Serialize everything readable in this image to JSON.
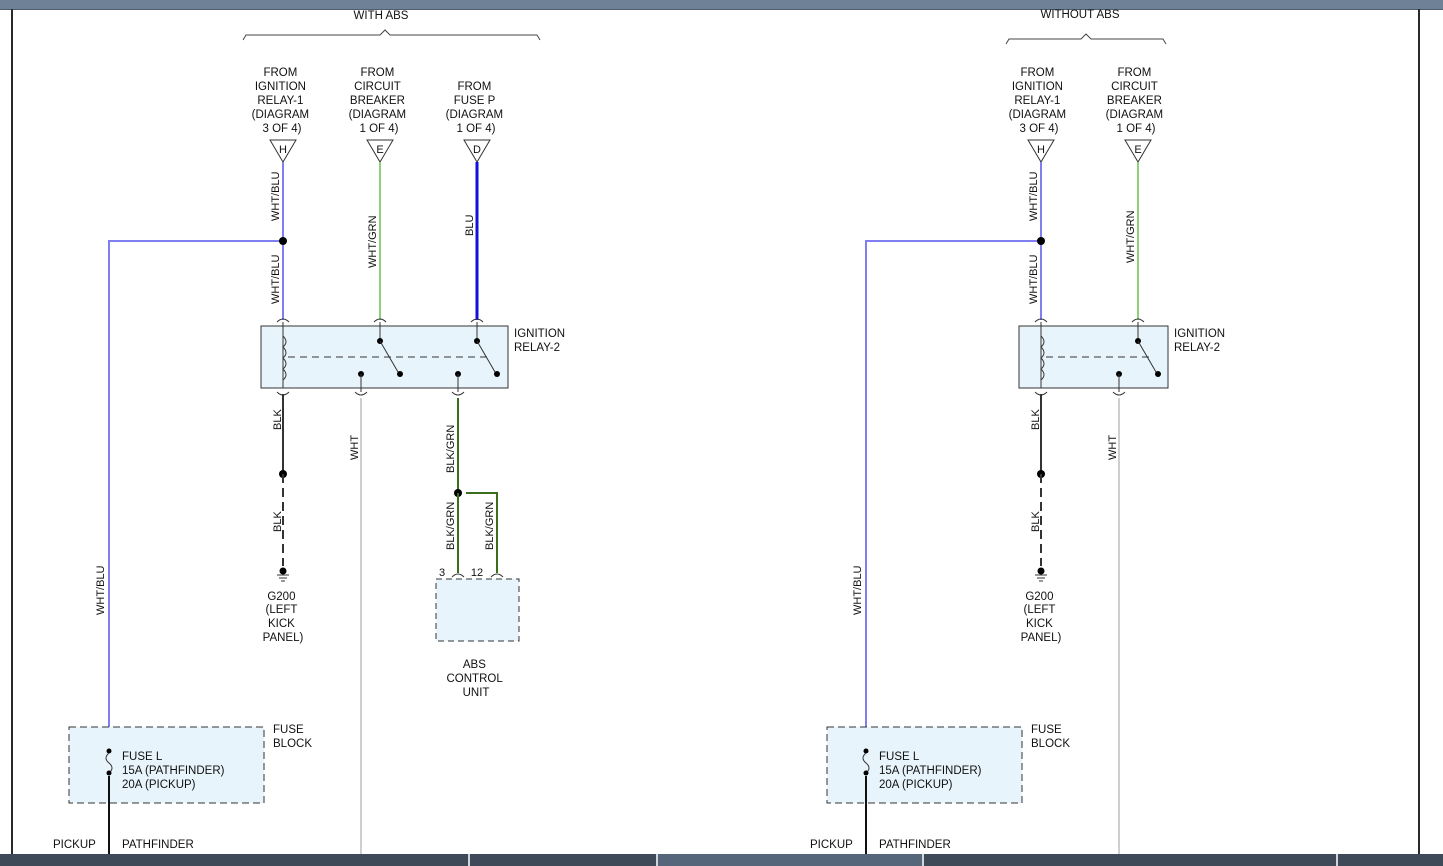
{
  "colors": {
    "wht_blu": "#7f7ff2",
    "wht_grn": "#8fcf7a",
    "blu": "#1010e0",
    "blk": "#333333",
    "blk_grn": "#3a6e1a",
    "wht": "#cfcfcf",
    "component_fill": "#e8f4fc",
    "topbar": "#6e8196",
    "bottombar": "#3e4a58"
  },
  "with_abs": {
    "section_title": "WITH ABS",
    "connectors": {
      "h": {
        "lines": [
          "FROM",
          "IGNITION",
          "RELAY-1",
          "(DIAGRAM",
          "3 OF 4)"
        ],
        "letter": "H"
      },
      "e": {
        "lines": [
          "FROM",
          "CIRCUIT",
          "BREAKER",
          "(DIAGRAM",
          "1 OF 4)"
        ],
        "letter": "E"
      },
      "d": {
        "lines": [
          "FROM",
          "FUSE P",
          "(DIAGRAM",
          "1 OF 4)"
        ],
        "letter": "D"
      }
    },
    "wires": {
      "h_top": "WHT/BLU",
      "h_mid": "WHT/BLU",
      "e_top": "WHT/GRN",
      "d_top": "BLU",
      "left_long": "WHT/BLU",
      "blk_top": "BLK",
      "blk_bottom": "BLK",
      "wht": "WHT",
      "blkgrn_top": "BLK/GRN",
      "blkgrn_left": "BLK/GRN",
      "blkgrn_right": "BLK/GRN"
    },
    "relay": {
      "lines": [
        "IGNITION",
        "RELAY-2"
      ]
    },
    "ground": {
      "lines": [
        "G200",
        "(LEFT",
        "KICK",
        "PANEL)"
      ]
    },
    "abs_unit": {
      "lines": [
        "ABS",
        "CONTROL",
        "UNIT"
      ],
      "pin_left": "3",
      "pin_right": "12"
    },
    "fuse_block": {
      "lines": [
        "FUSE",
        "BLOCK"
      ],
      "fuse_lines": [
        "FUSE L",
        "15A (PATHFINDER)",
        "20A (PICKUP)"
      ]
    },
    "bottom_left": "PICKUP",
    "bottom_right": "PATHFINDER"
  },
  "without_abs": {
    "section_title": "WITHOUT ABS",
    "connectors": {
      "h": {
        "lines": [
          "FROM",
          "IGNITION",
          "RELAY-1",
          "(DIAGRAM",
          "3 OF 4)"
        ],
        "letter": "H"
      },
      "e": {
        "lines": [
          "FROM",
          "CIRCUIT",
          "BREAKER",
          "(DIAGRAM",
          "1 OF 4)"
        ],
        "letter": "E"
      }
    },
    "wires": {
      "h_top": "WHT/BLU",
      "h_mid": "WHT/BLU",
      "e_top": "WHT/GRN",
      "left_long": "WHT/BLU",
      "blk_top": "BLK",
      "blk_bottom": "BLK",
      "wht": "WHT"
    },
    "relay": {
      "lines": [
        "IGNITION",
        "RELAY-2"
      ]
    },
    "ground": {
      "lines": [
        "G200",
        "(LEFT",
        "KICK",
        "PANEL)"
      ]
    },
    "fuse_block": {
      "lines": [
        "FUSE",
        "BLOCK"
      ],
      "fuse_lines": [
        "FUSE L",
        "15A (PATHFINDER)",
        "20A (PICKUP)"
      ]
    },
    "bottom_left": "PICKUP",
    "bottom_right": "PATHFINDER"
  }
}
